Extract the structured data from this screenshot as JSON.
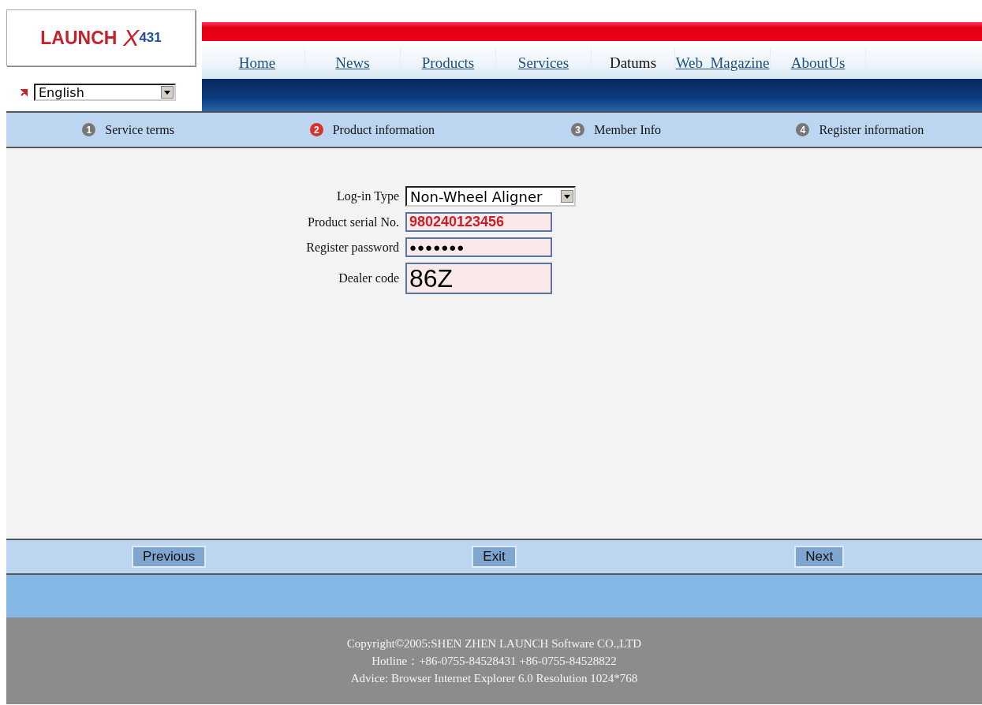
{
  "logo": {
    "brand": "LAUNCH",
    "mark": "X",
    "model": "431"
  },
  "language": {
    "value": "English"
  },
  "nav": [
    {
      "label": "Home",
      "selected": false
    },
    {
      "label": "News",
      "selected": false
    },
    {
      "label": "Products",
      "selected": false
    },
    {
      "label": "Services",
      "selected": false
    },
    {
      "label": "Datums",
      "selected": true
    },
    {
      "label": "Web_Magazine",
      "selected": false
    },
    {
      "label": "AboutUs",
      "selected": false
    }
  ],
  "steps": [
    {
      "number": "1",
      "label": "Service terms",
      "selected": false
    },
    {
      "number": "2",
      "label": "Product information",
      "selected": true
    },
    {
      "number": "3",
      "label": "Member Info",
      "selected": false
    },
    {
      "number": "4",
      "label": "Register information",
      "selected": false
    }
  ],
  "form": [
    {
      "kind": "select",
      "label": "Log-in Type",
      "value": "Non-Wheel Aligner"
    },
    {
      "kind": "serial",
      "label": "Product serial No.",
      "value": "980240123456"
    },
    {
      "kind": "password",
      "label": "Register password",
      "value": "●●●●●●●"
    },
    {
      "kind": "overlay",
      "label": "Dealer code",
      "value": "86Z"
    }
  ],
  "buttons": [
    "Previous",
    "Exit",
    "Next"
  ],
  "footer": [
    "Copyright©2005:SHEN ZHEN LAUNCH Software CO.,LTD",
    "Hotline：+86-0755-84528431  +86-0755-84528822",
    "Advice: Browser Internet Explorer 6.0  Resolution 1024*768"
  ]
}
